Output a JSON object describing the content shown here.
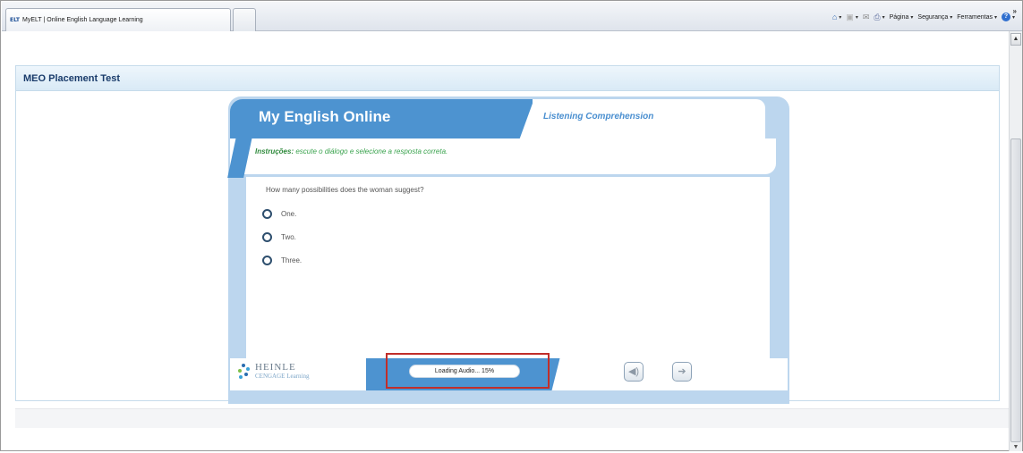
{
  "browser": {
    "tab_favicon": "ELT",
    "tab_title": "MyELT | Online English Language Learning",
    "commands": [
      {
        "icon": "home-icon",
        "label": ""
      },
      {
        "icon": "feed-icon",
        "label": ""
      },
      {
        "icon": "read-mail-icon",
        "label": ""
      },
      {
        "icon": "print-icon",
        "label": ""
      },
      {
        "icon": "page-icon",
        "label": "Página"
      },
      {
        "icon": "safety-icon",
        "label": "Segurança"
      },
      {
        "icon": "tools-icon",
        "label": "Ferramentas"
      },
      {
        "icon": "help-icon",
        "label": ""
      }
    ],
    "more_chevron": "»"
  },
  "panel": {
    "title": "MEO Placement Test"
  },
  "player": {
    "brand_title": "My English Online",
    "section_title": "Listening Comprehension",
    "instructions_label": "Instruções:",
    "instructions_text": "escute o diálogo e selecione a resposta correta.",
    "question": "How many possibilities does the woman suggest?",
    "options": [
      "One.",
      "Two.",
      "Three."
    ],
    "publisher_name": "HEINLE",
    "publisher_sub": "CENGAGE Learning",
    "loading_text": "Loading Audio... 15%",
    "loading_progress": 0.15
  },
  "colors": {
    "brand_blue": "#4d93d0",
    "panel_blue": "#bcd6ee",
    "instructions_green": "#3aa34e",
    "highlight_red": "#c12e2a"
  }
}
